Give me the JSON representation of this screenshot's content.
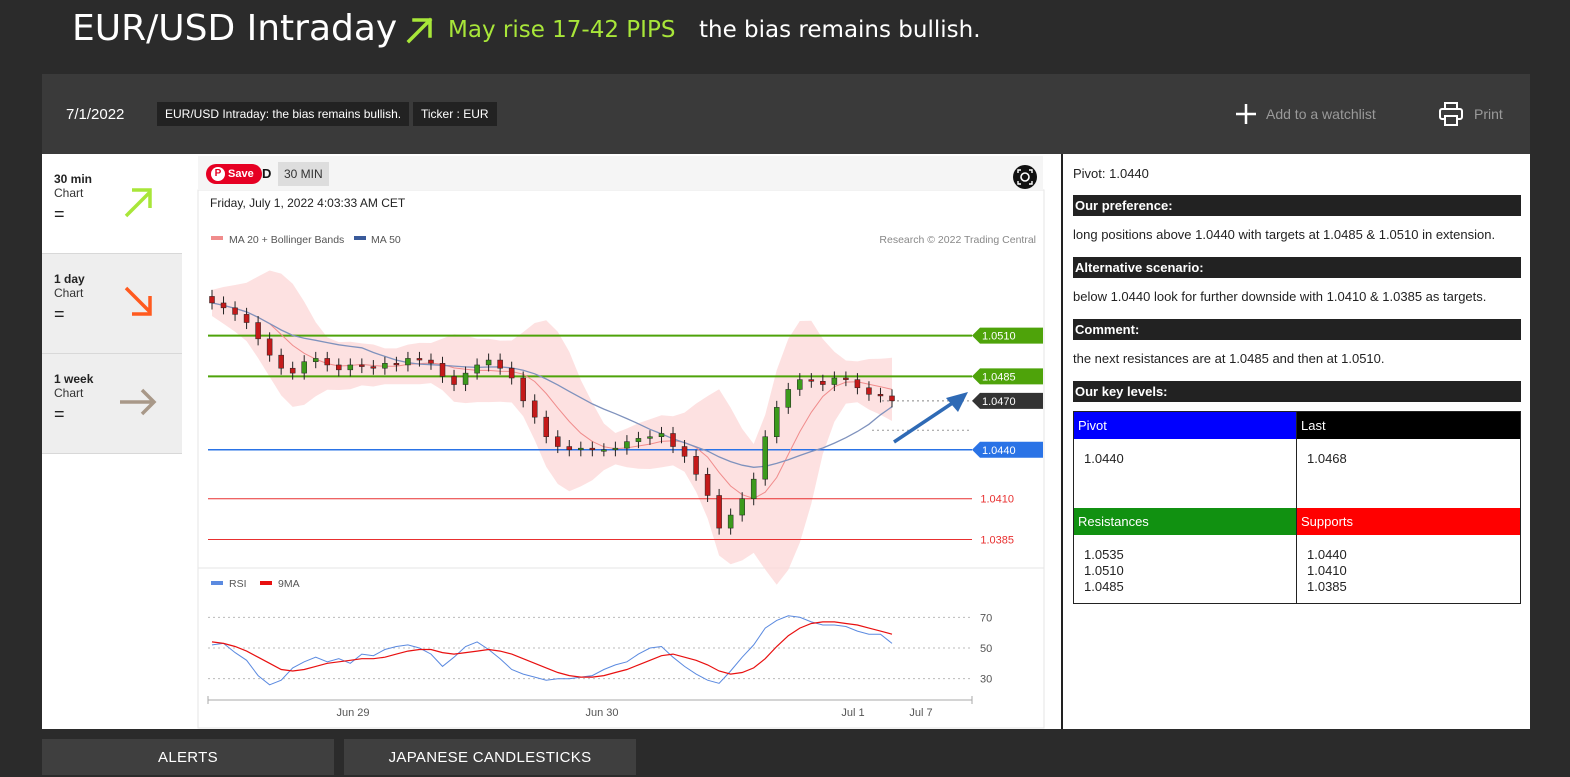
{
  "header": {
    "title": "EUR/USD Intraday",
    "rise": "May rise 17-42 PIPS",
    "bias": "the bias remains bullish."
  },
  "toolbar": {
    "date": "7/1/2022",
    "tag_title": "EUR/USD Intraday: the bias remains bullish.",
    "tag_ticker": "Ticker : EUR",
    "watchlist": "Add to a watchlist",
    "print": "Print"
  },
  "sidebar": {
    "items": [
      {
        "label": "30 min",
        "sub": "Chart",
        "status": "=",
        "direction": "up"
      },
      {
        "label": "1 day",
        "sub": "Chart",
        "status": "=",
        "direction": "down"
      },
      {
        "label": "1 week",
        "sub": "Chart",
        "status": "=",
        "direction": "right"
      }
    ]
  },
  "chart_header": {
    "save": "Save",
    "d_letter": "D",
    "timeframe": "30 MIN",
    "datetime": "Friday, July 1, 2022 4:03:33 AM CET",
    "legend_ma20": "MA 20 + Bollinger Bands",
    "legend_ma50": "MA 50",
    "copyright": "Research © 2022 Trading Central",
    "rsi_legend": "RSI",
    "ma9_legend": "9MA"
  },
  "chart_data": {
    "type": "line",
    "levels": [
      {
        "value": 1.051,
        "label": "1.0510",
        "kind": "resistance"
      },
      {
        "value": 1.0485,
        "label": "1.0485",
        "kind": "resistance"
      },
      {
        "value": 1.047,
        "label": "1.0470",
        "kind": "last"
      },
      {
        "value": 1.044,
        "label": "1.0440",
        "kind": "pivot"
      },
      {
        "value": 1.041,
        "label": "1.0410",
        "kind": "support"
      },
      {
        "value": 1.0385,
        "label": "1.0385",
        "kind": "support"
      }
    ],
    "x_ticks": [
      "Jun 29",
      "Jun 30",
      "Jul 1",
      "Jul 7"
    ],
    "rsi_ticks": [
      "70",
      "50",
      "30"
    ],
    "price_close": [
      1.053,
      1.0527,
      1.0523,
      1.0518,
      1.0508,
      1.0498,
      1.049,
      1.0487,
      1.0494,
      1.0496,
      1.0492,
      1.0489,
      1.0492,
      1.0491,
      1.049,
      1.0493,
      1.0492,
      1.0496,
      1.0495,
      1.0493,
      1.0485,
      1.048,
      1.0487,
      1.0492,
      1.0495,
      1.049,
      1.0484,
      1.047,
      1.046,
      1.0448,
      1.0442,
      1.044,
      1.0441,
      1.044,
      1.044,
      1.0441,
      1.0445,
      1.0447,
      1.0448,
      1.045,
      1.0442,
      1.0436,
      1.0425,
      1.0412,
      1.0392,
      1.04,
      1.041,
      1.0422,
      1.0448,
      1.0466,
      1.0477,
      1.0483,
      1.0482,
      1.048,
      1.0484,
      1.0483,
      1.0478,
      1.0474,
      1.0473,
      1.047
    ],
    "rsi": [
      52,
      53,
      47,
      42,
      32,
      26,
      29,
      37,
      41,
      44,
      41,
      43,
      40,
      46,
      45,
      49,
      51,
      52,
      50,
      46,
      38,
      44,
      51,
      54,
      49,
      43,
      36,
      33,
      31,
      29,
      30,
      30,
      31,
      32,
      36,
      39,
      41,
      46,
      50,
      51,
      44,
      38,
      33,
      29,
      27,
      35,
      44,
      52,
      63,
      68,
      71,
      70,
      67,
      65,
      65,
      64,
      61,
      59,
      59,
      53
    ],
    "rsi_ma": [
      54,
      53,
      51,
      48,
      44,
      40,
      36,
      35,
      36,
      38,
      40,
      41,
      42,
      43,
      43,
      44,
      46,
      48,
      49,
      49,
      47,
      46,
      47,
      48,
      49,
      48,
      46,
      43,
      40,
      37,
      34,
      32,
      31,
      31,
      32,
      34,
      36,
      39,
      42,
      45,
      46,
      44,
      42,
      39,
      35,
      33,
      34,
      37,
      43,
      51,
      58,
      63,
      66,
      67,
      67,
      66,
      65,
      63,
      61,
      59
    ]
  },
  "right": {
    "pivot": "Pivot: 1.0440",
    "preference_head": "Our preference:",
    "preference": "long positions above 1.0440 with targets at 1.0485 & 1.0510 in extension.",
    "alt_head": "Alternative scenario:",
    "alt": "below 1.0440 look for further downside with 1.0410 & 1.0385 as targets.",
    "comment_head": "Comment:",
    "comment": "the next resistances are at 1.0485 and then at 1.0510.",
    "key_head": "Our key levels:",
    "kl": {
      "pivot_h": "Pivot",
      "last_h": "Last",
      "pivot_v": "1.0440",
      "last_v": "1.0468",
      "res_h": "Resistances",
      "sup_h": "Supports",
      "res": [
        "1.0535",
        "1.0510",
        "1.0485"
      ],
      "sup": [
        "1.0440",
        "1.0410",
        "1.0385"
      ]
    }
  },
  "tabs": {
    "alerts": "ALERTS",
    "candles": "JAPANESE CANDLESTICKS"
  },
  "colors": {
    "bullish": "#a8e639",
    "bearish": "#ff5a1f",
    "neutral": "#a89888",
    "resistance": "#4ea30a",
    "support": "#e83030",
    "pivot": "#2a73e6"
  }
}
